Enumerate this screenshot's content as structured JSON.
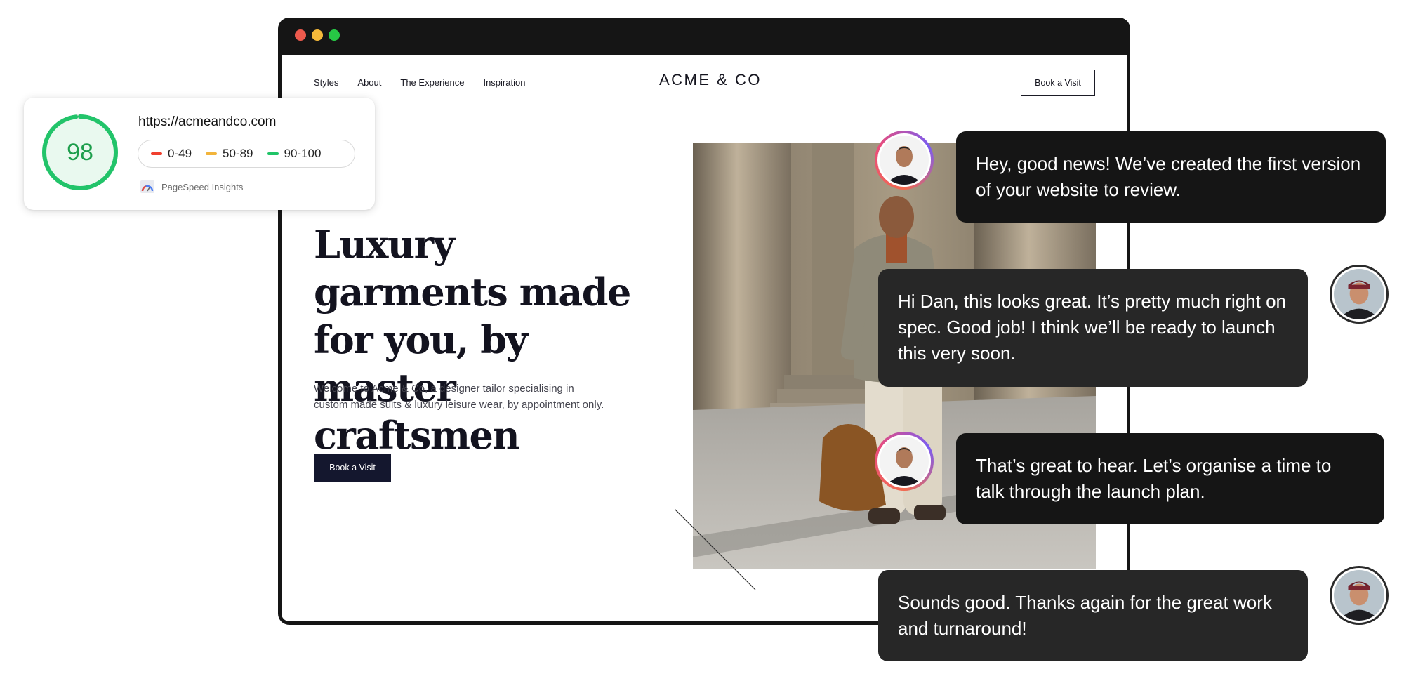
{
  "browser": {
    "window_controls": [
      "close",
      "minimize",
      "maximize"
    ]
  },
  "site": {
    "nav": [
      "Styles",
      "About",
      "The Experience",
      "Inspiration"
    ],
    "logo": "ACME & CO",
    "nav_cta": "Book a Visit",
    "hero": {
      "title": "Luxury garments made for you, by master craftsmen",
      "text": "Welcome to Acme & Co, a designer tailor specialising in custom made suits & luxury leisure wear, by appointment only.",
      "cta": "Book a Visit"
    }
  },
  "pagespeed": {
    "score": "98",
    "score_fraction": 0.98,
    "url": "https://acmeandco.com",
    "legend": [
      {
        "label": "0-49",
        "color": "#f0402f"
      },
      {
        "label": "50-89",
        "color": "#f2b43b"
      },
      {
        "label": "90-100",
        "color": "#1fc467"
      }
    ],
    "brand": "PageSpeed Insights",
    "ring_color": "#22c46a"
  },
  "chat": {
    "messages": [
      {
        "from": "agency",
        "text": "Hey, good news! We’ve created the first version of your website to review."
      },
      {
        "from": "client",
        "text": "Hi Dan, this looks great. It’s pretty much right on spec. Good job! I think we’ll be ready to launch this very soon."
      },
      {
        "from": "agency",
        "text": "That’s great to hear. Let’s organise a time to talk through the launch plan."
      },
      {
        "from": "client",
        "text": "Sounds good. Thanks again for the great work and turnaround!"
      }
    ]
  }
}
